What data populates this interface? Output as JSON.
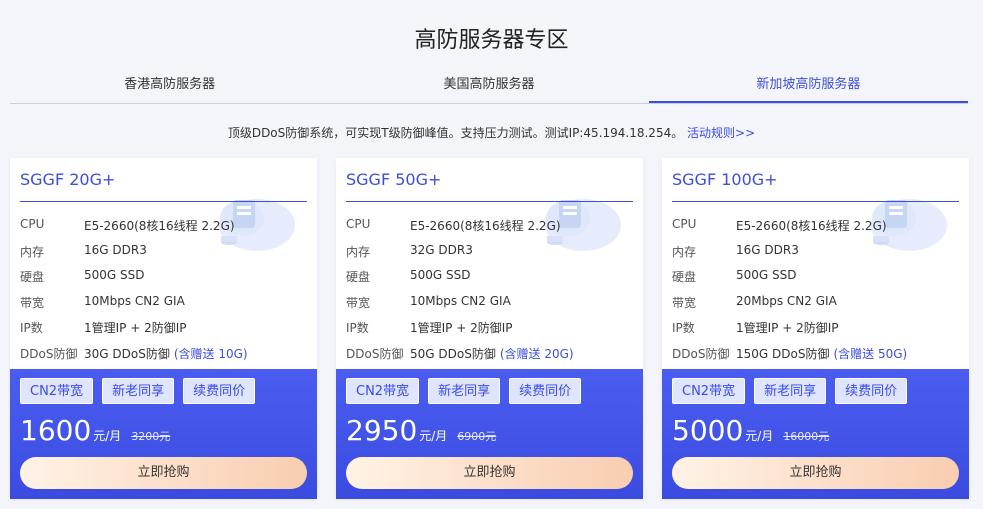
{
  "page_title": "高防服务器专区",
  "tabs": [
    {
      "label": "香港高防服务器"
    },
    {
      "label": "美国高防服务器"
    },
    {
      "label": "新加坡高防服务器"
    }
  ],
  "notice": {
    "text": "顶级DDoS防御系统，可实现T级防御峰值。支持压力测试。测试IP:45.194.18.254。",
    "link": "活动规则>>"
  },
  "spec_labels": {
    "cpu": "CPU",
    "ram": "内存",
    "disk": "硬盘",
    "bandwidth": "带宽",
    "ip": "IP数",
    "ddos": "DDoS防御"
  },
  "tags": [
    "CN2带宽",
    "新老同享",
    "续费同价"
  ],
  "buy_label": "立即抢购",
  "price_unit": "元/月",
  "cards": [
    {
      "name": "SGGF 20G+",
      "cpu": "E5-2660(8核16线程 2.2G)",
      "ram": "16G DDR3",
      "disk": "500G SSD",
      "bandwidth": "10Mbps CN2 GIA",
      "ip": "1管理IP + 2防御IP",
      "ddos": "30G DDoS防御",
      "ddos_gift": "(含赠送 10G)",
      "price": "1600",
      "old_price": "3200元"
    },
    {
      "name": "SGGF 50G+",
      "cpu": "E5-2660(8核16线程 2.2G)",
      "ram": "32G DDR3",
      "disk": "500G SSD",
      "bandwidth": "10Mbps CN2 GIA",
      "ip": "1管理IP + 2防御IP",
      "ddos": "50G DDoS防御",
      "ddos_gift": "(含赠送 20G)",
      "price": "2950",
      "old_price": "6900元"
    },
    {
      "name": "SGGF 100G+",
      "cpu": "E5-2660(8核16线程 2.2G)",
      "ram": "16G DDR3",
      "disk": "500G SSD",
      "bandwidth": "20Mbps CN2 GIA",
      "ip": "1管理IP + 2防御IP",
      "ddos": "150G DDoS防御",
      "ddos_gift": "(含赠送 50G)",
      "price": "5000",
      "old_price": "16000元"
    }
  ]
}
